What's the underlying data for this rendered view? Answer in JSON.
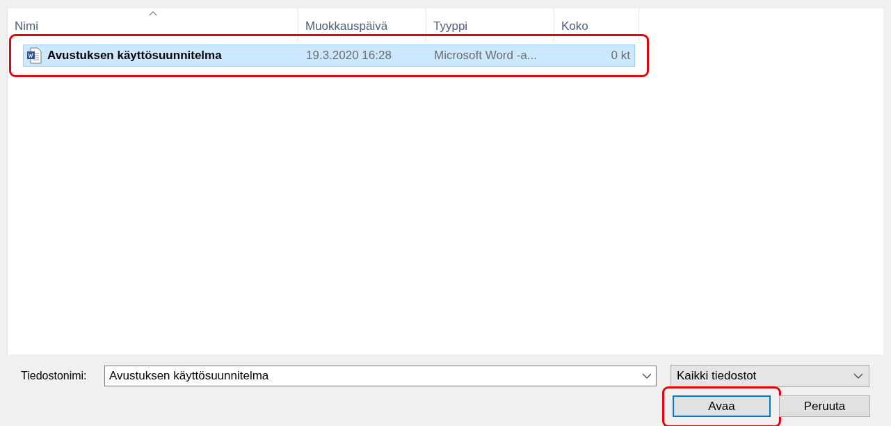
{
  "columns": [
    {
      "label": "Nimi",
      "sorted": true
    },
    {
      "label": "Muokkauspäivä",
      "sorted": false
    },
    {
      "label": "Tyyppi",
      "sorted": false
    },
    {
      "label": "Koko",
      "sorted": false
    }
  ],
  "files": [
    {
      "name": "Avustuksen käyttösuunnitelma",
      "modified": "19.3.2020 16:28",
      "type": "Microsoft Word -a...",
      "size": "0 kt",
      "selected": true,
      "highlighted": true
    }
  ],
  "filename": {
    "label": "Tiedostonimi:",
    "value": "Avustuksen käyttösuunnitelma"
  },
  "filter": {
    "value": "Kaikki tiedostot"
  },
  "buttons": [
    {
      "label": "Avaa",
      "default": true,
      "highlighted": true
    },
    {
      "label": "Peruuta",
      "default": false,
      "highlighted": false
    }
  ]
}
